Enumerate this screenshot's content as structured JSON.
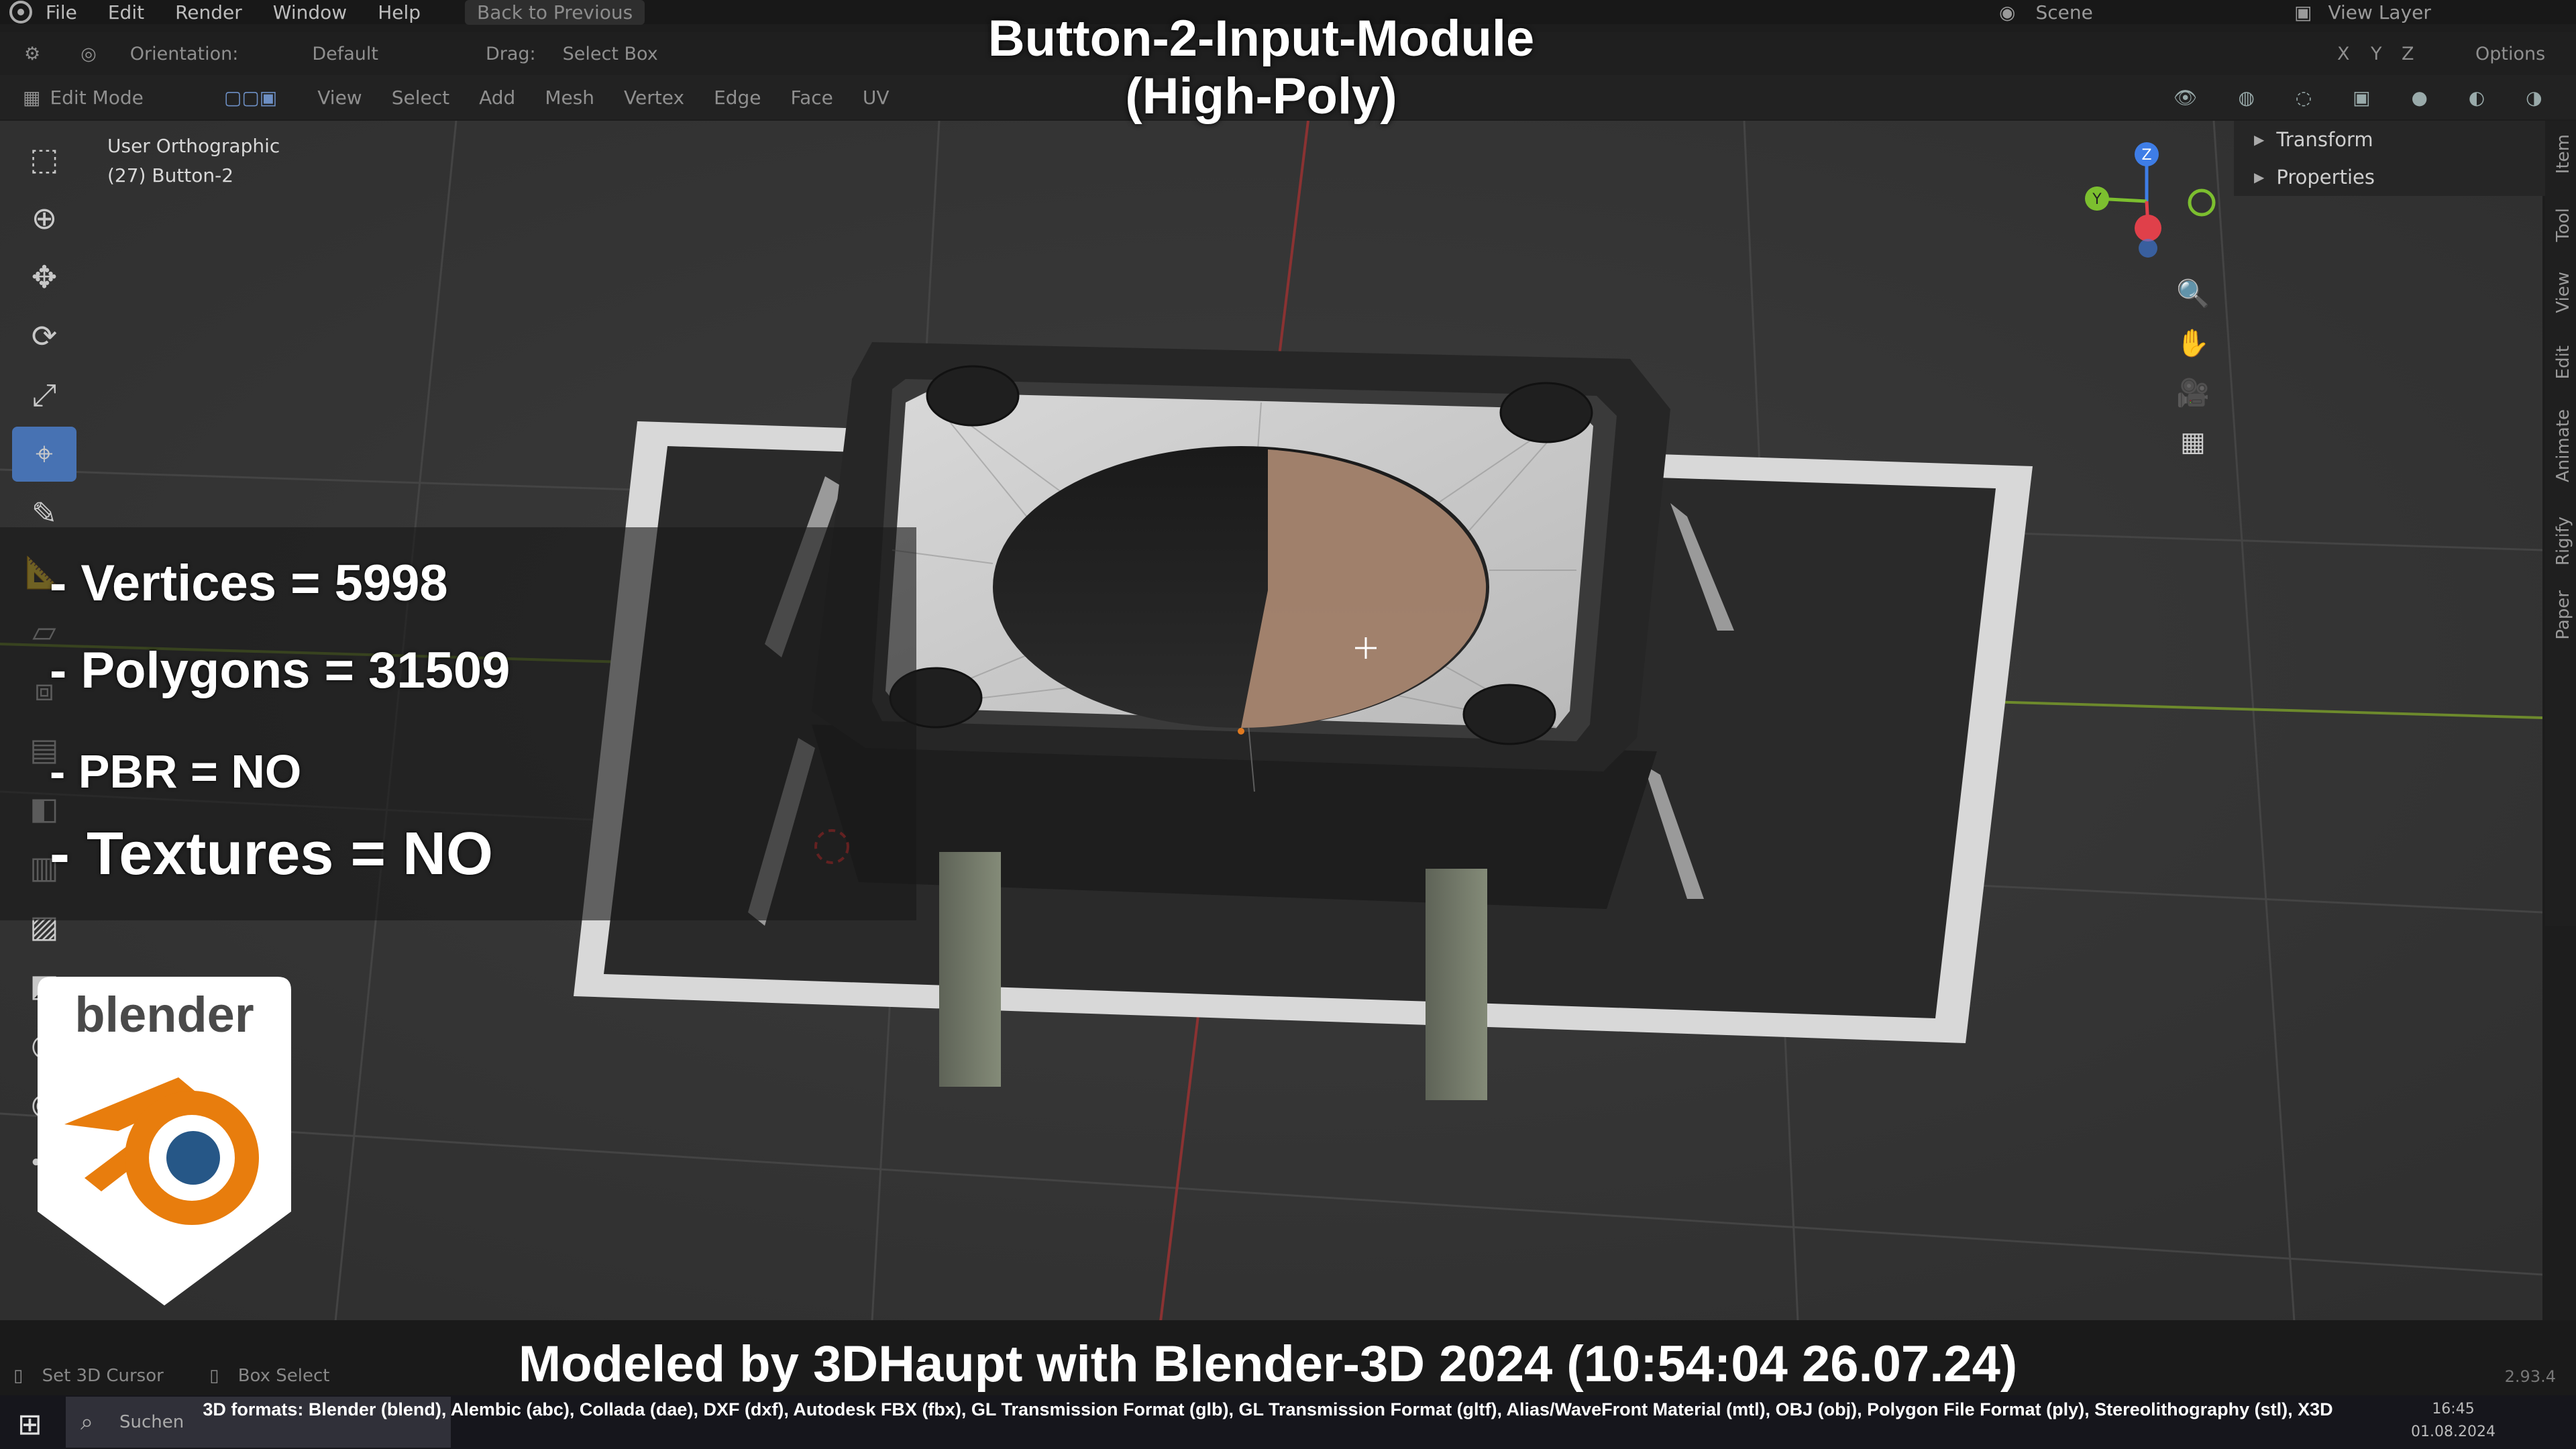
{
  "menu": {
    "items": [
      "File",
      "Edit",
      "Render",
      "Window",
      "Help"
    ],
    "back_button": "Back to Previous",
    "scene": "Scene",
    "view_layer": "View Layer"
  },
  "tool_header": {
    "orientation_label": "Orientation:",
    "orientation_value": "Default",
    "drag_label": "Drag:",
    "drag_value": "Select Box",
    "options": "Options"
  },
  "mode_header": {
    "mode": "Edit Mode",
    "menus": [
      "View",
      "Select",
      "Add",
      "Mesh",
      "Vertex",
      "Edge",
      "Face",
      "UV"
    ]
  },
  "axes_toggle": [
    "X",
    "Y",
    "Z"
  ],
  "viewport": {
    "view_name": "User Orthographic",
    "object": "(27) Button-2"
  },
  "n_panel": {
    "sections": [
      "Transform",
      "Properties"
    ],
    "tabs": [
      "Item",
      "Tool",
      "View",
      "Edit",
      "Animate",
      "Rigify",
      "Paper"
    ]
  },
  "gizmo_labels": {
    "z": "Z",
    "y": "Y"
  },
  "overlay": {
    "title_line1": "Button-2-Input-Module",
    "title_line2": "(High-Poly)",
    "stats": [
      "- Vertices = 5998",
      "- Polygons = 31509",
      "- PBR =  NO",
      "- Textures = NO"
    ],
    "logo_text": "blender",
    "credit": "Modeled by 3DHaupt with Blender-3D 2024 (10:54:04  26.07.24)",
    "formats": "3D formats: Blender (blend), Alembic (abc), Collada (dae), DXF (dxf), Autodesk FBX (fbx), GL Transmission Format (glb), GL Transmission Format (gltf), Alias/WaveFront Material (mtl), OBJ (obj), Polygon File Format (ply), Stereolithography (stl), X3D"
  },
  "status_bar": {
    "left1": "Set 3D Cursor",
    "left2": "Box Select",
    "version": "2.93.4"
  },
  "taskbar": {
    "search": "Suchen",
    "time": "16:45",
    "date": "01.08.2024"
  },
  "colors": {
    "accent": "#4772b3",
    "viewport_bg": "#383838",
    "gizmo_x": "#e0404a",
    "gizmo_y": "#7cbf2f",
    "gizmo_z": "#3e7de6",
    "blender_orange": "#e87d0d",
    "blender_blue": "#265787"
  }
}
